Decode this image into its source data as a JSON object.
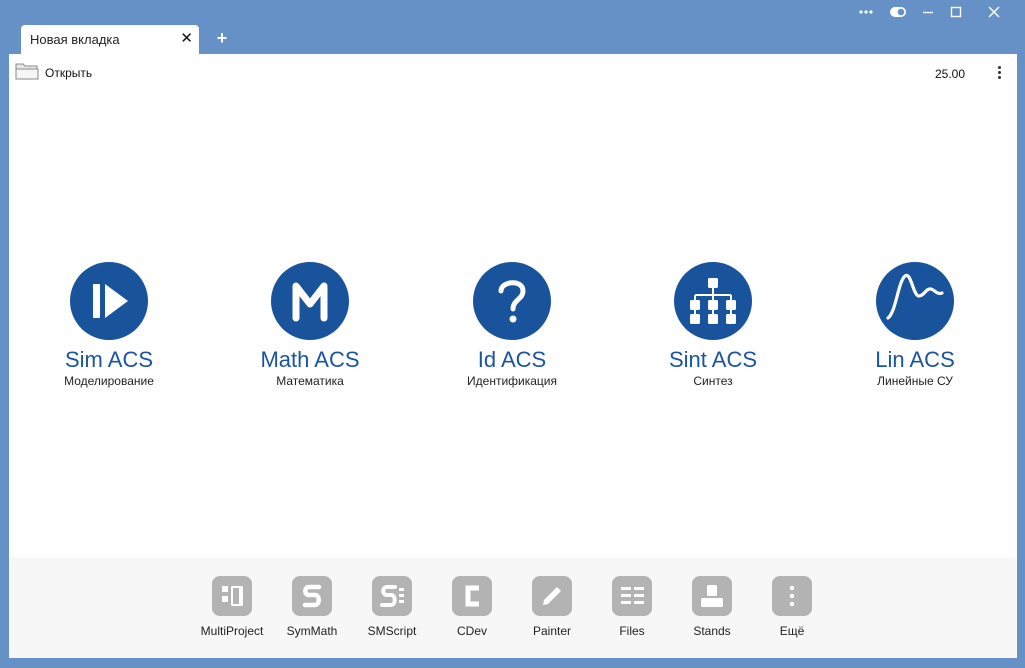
{
  "window": {
    "tab_title": "Новая вкладка",
    "tab_close": "✕",
    "new_tab": "+"
  },
  "toolbar": {
    "open_label": "Открыть",
    "version": "25.00"
  },
  "apps": [
    {
      "title": "Sim ACS",
      "subtitle": "Моделирование",
      "icon": "play-step-icon"
    },
    {
      "title": "Math ACS",
      "subtitle": "Математика",
      "icon": "m-letter-icon"
    },
    {
      "title": "Id ACS",
      "subtitle": "Идентификация",
      "icon": "question-icon"
    },
    {
      "title": "Sint ACS",
      "subtitle": "Синтез",
      "icon": "hierarchy-icon"
    },
    {
      "title": "Lin ACS",
      "subtitle": "Линейные СУ",
      "icon": "step-response-icon"
    }
  ],
  "tools": [
    {
      "label": "MultiProject",
      "icon": "multiproject-icon"
    },
    {
      "label": "SymMath",
      "icon": "symmath-icon"
    },
    {
      "label": "SMScript",
      "icon": "smscript-icon"
    },
    {
      "label": "CDev",
      "icon": "cdev-icon"
    },
    {
      "label": "Painter",
      "icon": "pencil-icon"
    },
    {
      "label": "Files",
      "icon": "files-icon"
    },
    {
      "label": "Stands",
      "icon": "stands-icon"
    },
    {
      "label": "Ещё",
      "icon": "more-icon"
    }
  ],
  "colors": {
    "frame": "#6591c7",
    "app_accent": "#19539b",
    "tool_icon_bg": "#b3b3b3"
  }
}
